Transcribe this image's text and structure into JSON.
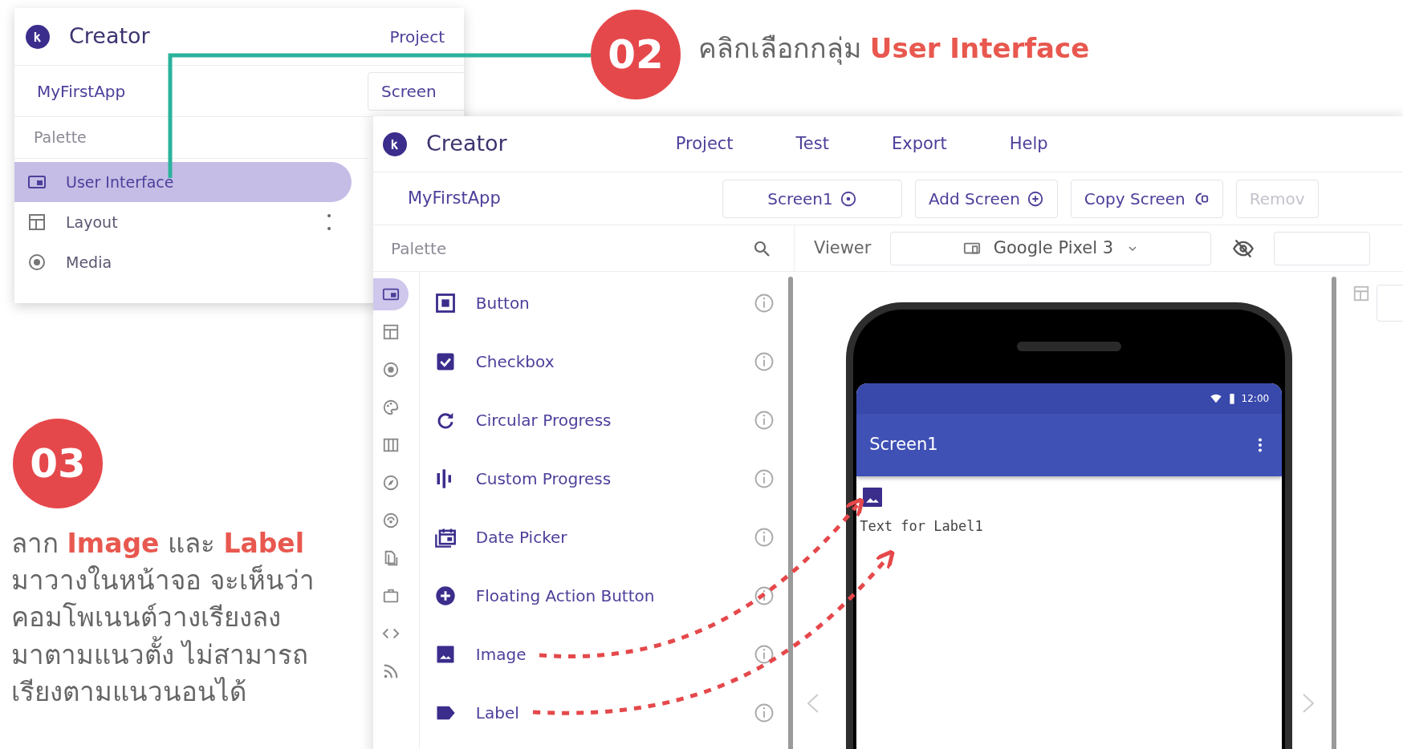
{
  "step_02": {
    "number": "02",
    "caption": "คลิกเลือกกลุ่ม **User Interface**"
  },
  "inset": {
    "brand": "Creator",
    "menu": [
      "Project"
    ],
    "project": "MyFirstApp",
    "screen_button": "Screen",
    "palette_title": "Palette",
    "categories": [
      {
        "label": "User Interface",
        "kind": "ui",
        "selected": true
      },
      {
        "label": "Layout",
        "kind": "layout",
        "selected": false
      },
      {
        "label": "Media",
        "kind": "media",
        "selected": false
      }
    ]
  },
  "main": {
    "brand": "Creator",
    "menu": [
      "Project",
      "Test",
      "Export",
      "Help"
    ],
    "project": "MyFirstApp",
    "toolbar_buttons": [
      {
        "label": "Screen1",
        "kind": "select",
        "disabled": false
      },
      {
        "label": "Add Screen",
        "kind": "add",
        "disabled": false
      },
      {
        "label": "Copy Screen",
        "kind": "copy",
        "disabled": false
      },
      {
        "label": "Remov",
        "kind": "plain",
        "disabled": true
      }
    ],
    "palette_title": "Palette",
    "viewer_label": "Viewer",
    "device": "Google Pixel 3",
    "category_rail": [
      {
        "kind": "ui",
        "selected": true
      },
      {
        "kind": "layout",
        "selected": false
      },
      {
        "kind": "media",
        "selected": false
      },
      {
        "kind": "palette",
        "selected": false
      },
      {
        "kind": "columns",
        "selected": false
      },
      {
        "kind": "compass",
        "selected": false
      },
      {
        "kind": "sensor",
        "selected": false
      },
      {
        "kind": "pages",
        "selected": false
      },
      {
        "kind": "briefcase",
        "selected": false
      },
      {
        "kind": "code",
        "selected": false
      },
      {
        "kind": "feed",
        "selected": false
      }
    ],
    "components": [
      {
        "label": "Button",
        "kind": "button"
      },
      {
        "label": "Checkbox",
        "kind": "checkbox"
      },
      {
        "label": "Circular Progress",
        "kind": "circular"
      },
      {
        "label": "Custom Progress",
        "kind": "custom"
      },
      {
        "label": "Date Picker",
        "kind": "date"
      },
      {
        "label": "Floating Action Button",
        "kind": "fab"
      },
      {
        "label": "Image",
        "kind": "image"
      },
      {
        "label": "Label",
        "kind": "label"
      }
    ],
    "phone": {
      "title": "Screen1",
      "time": "12:00",
      "label_text": "Text for Label1"
    }
  },
  "step_03": {
    "number": "03",
    "caption": "ลาก **Image** และ **Label**\nมาวางในหน้าจอ จะเห็นว่า\nคอมโพเนนต์วางเรียงลง\nมาตามแนวตั้ง ไม่สามารถ\nเรียงตามแนวนอนได้"
  }
}
